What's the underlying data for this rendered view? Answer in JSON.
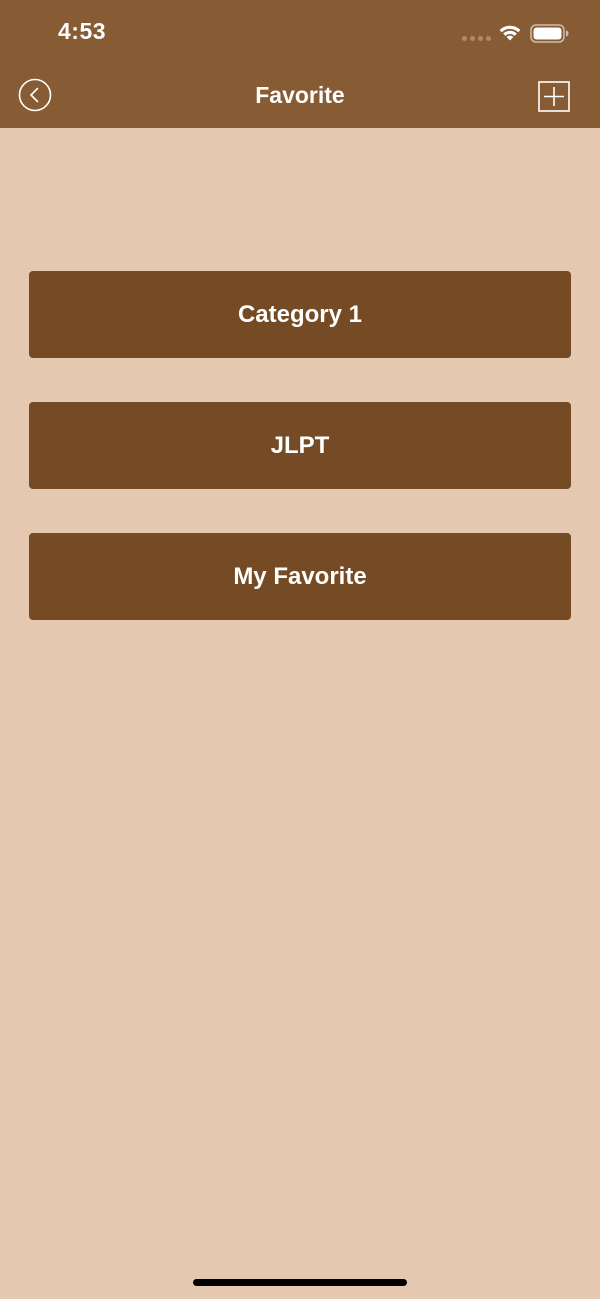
{
  "status_bar": {
    "time": "4:53"
  },
  "nav_bar": {
    "title": "Favorite",
    "back_icon": "chevron-left-circle-icon",
    "add_icon": "plus-square-icon"
  },
  "categories": [
    {
      "label": "Category 1"
    },
    {
      "label": "JLPT"
    },
    {
      "label": "My Favorite"
    }
  ],
  "colors": {
    "header": "#875b34",
    "background": "#e4c8b0",
    "button": "#744b24",
    "text": "#ffffff"
  }
}
